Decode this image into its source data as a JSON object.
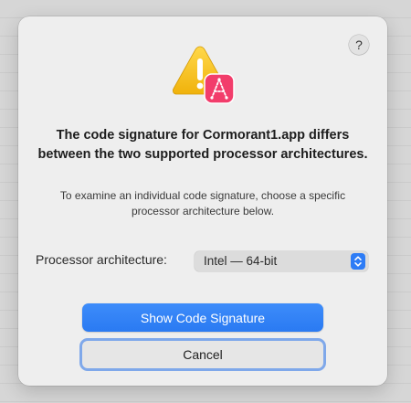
{
  "dialog": {
    "help_label": "?",
    "title": "The code signature for Cormorant1.app differs between the two supported processor architectures.",
    "message": "To examine an individual code signature, choose a specific processor architecture below.",
    "arch_label": "Processor architecture:",
    "arch_selected": "Intel — 64-bit",
    "show_button": "Show Code Signature",
    "cancel_button": "Cancel",
    "icons": {
      "alert": "warning-triangle-icon",
      "badge": "app-badge-icon",
      "popup": "chevron-up-down-icon"
    },
    "colors": {
      "accent": "#2a7af2",
      "warning": "#f7c51c",
      "badge": "#f23d6b",
      "focus_ring": "#7fa8ea"
    }
  }
}
